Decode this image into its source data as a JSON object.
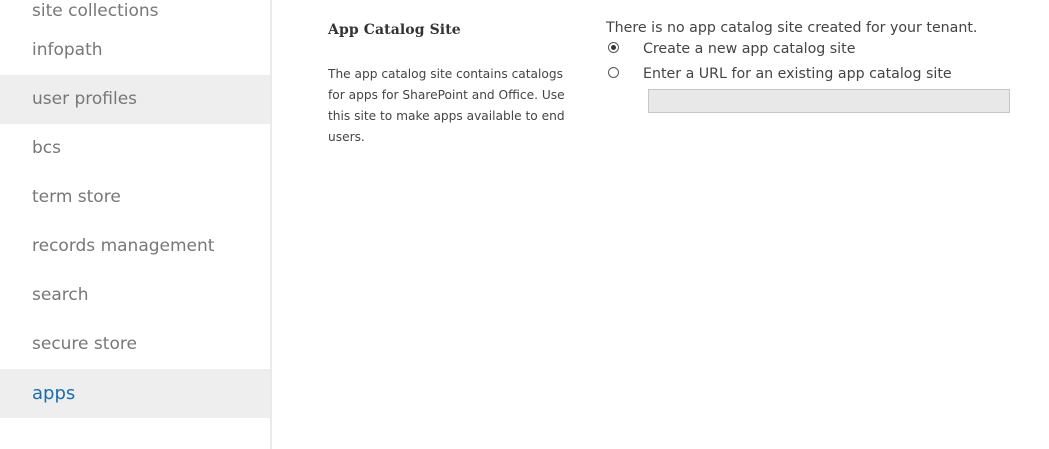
{
  "sidebar": {
    "items": [
      {
        "label": "site collections"
      },
      {
        "label": "infopath"
      },
      {
        "label": "user profiles"
      },
      {
        "label": "bcs"
      },
      {
        "label": "term store"
      },
      {
        "label": "records management"
      },
      {
        "label": "search"
      },
      {
        "label": "secure store"
      },
      {
        "label": "apps"
      }
    ],
    "selected": "apps"
  },
  "section": {
    "title": "App Catalog Site",
    "description": "The app catalog site contains catalogs for apps for SharePoint and Office. Use this site to make apps available to end users."
  },
  "options": {
    "status": "There is no app catalog site created for your tenant.",
    "create_label": "Create a new app catalog site",
    "create_checked": true,
    "existing_label": "Enter a URL for an existing app catalog site",
    "existing_checked": false,
    "url_value": "",
    "url_placeholder": ""
  }
}
